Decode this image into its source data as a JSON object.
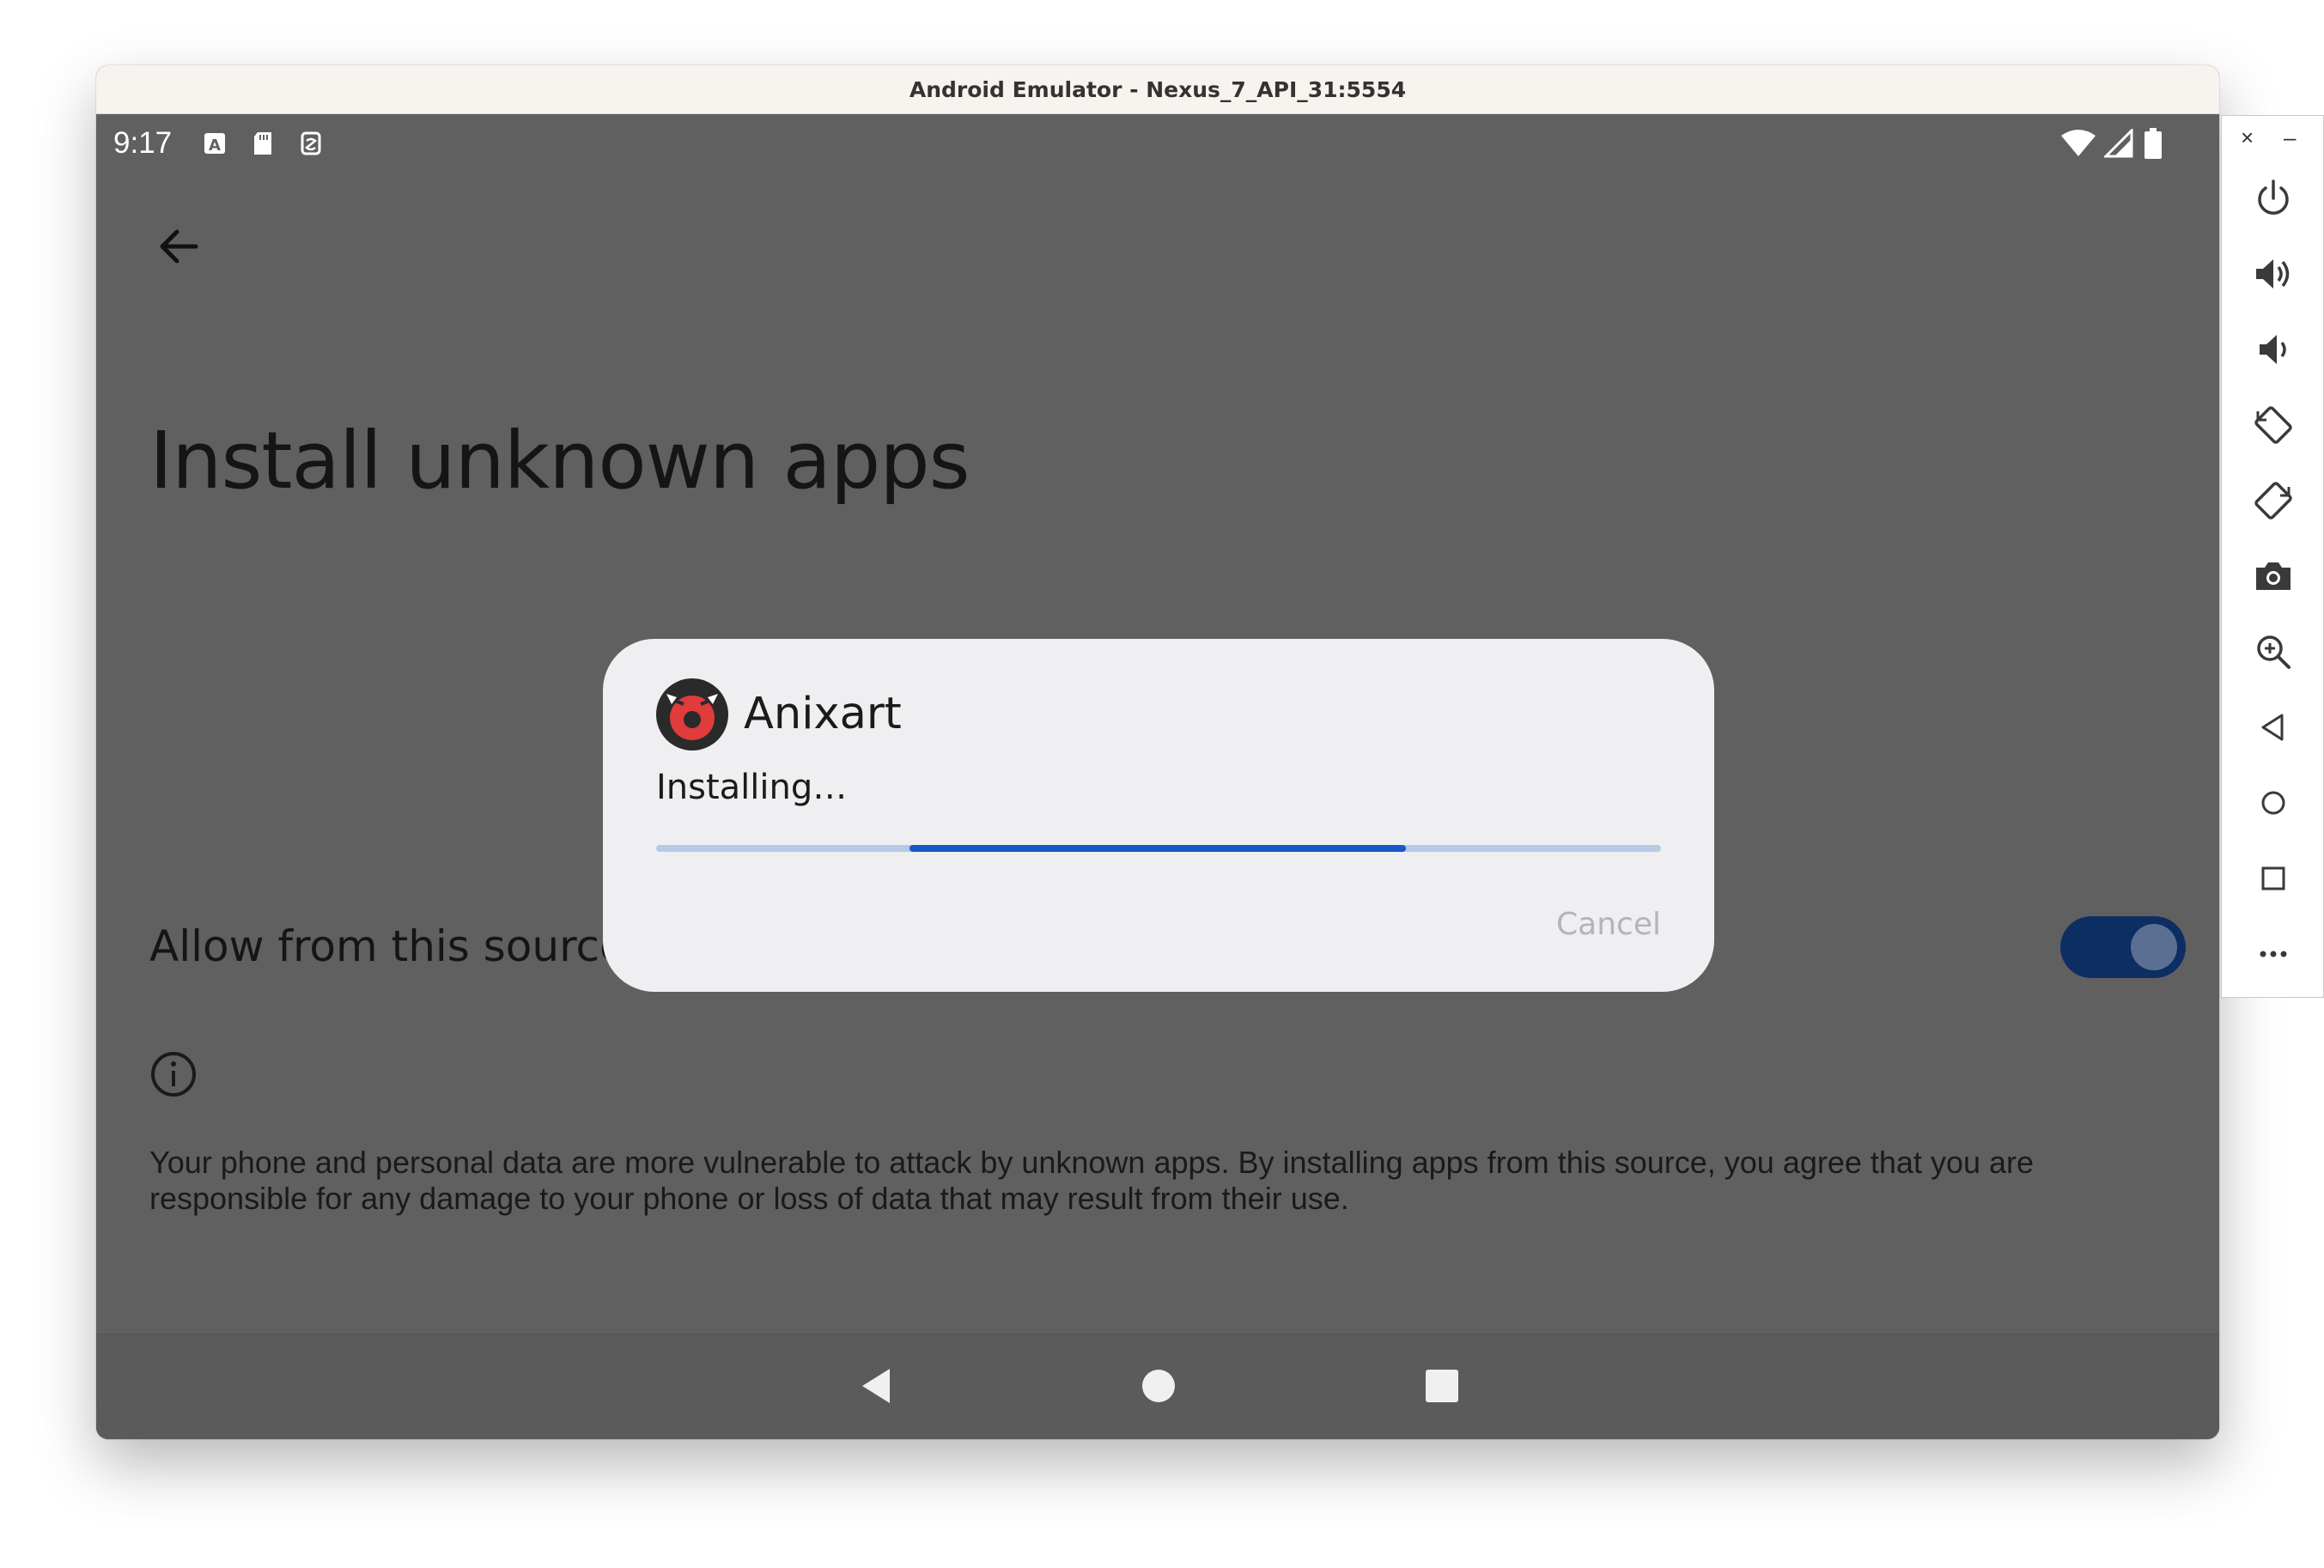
{
  "window": {
    "title": "Android Emulator - Nexus_7_API_31:5554"
  },
  "statusbar": {
    "time": "9:17",
    "left_icons": [
      "a-notification-icon",
      "sd-card-icon",
      "sim-icon"
    ],
    "right_icons": [
      "wifi-icon",
      "signal-icon",
      "battery-icon"
    ]
  },
  "page": {
    "title": "Install unknown apps",
    "allow_label": "Allow from this source",
    "allow_enabled": true,
    "warning_text": "Your phone and personal data are more vulnerable to attack by unknown apps. By installing apps from this source, you agree that you are responsible for any damage to your phone or loss of data that may result from their use."
  },
  "dialog": {
    "app_name": "Anixart",
    "status": "Installing…",
    "progress_indeterminate": true,
    "cancel_label": "Cancel"
  },
  "navbar": {
    "buttons": [
      "back-icon",
      "home-icon",
      "recents-icon"
    ]
  },
  "side_panel": {
    "top_controls": [
      "×",
      "–"
    ],
    "buttons": [
      "power-icon",
      "volume-up-icon",
      "volume-down-icon",
      "rotate-left-icon",
      "rotate-right-icon",
      "camera-icon",
      "zoom-icon",
      "back-icon",
      "home-icon",
      "overview-icon",
      "more-icon"
    ]
  },
  "colors": {
    "screen_bg": "#606060",
    "dialog_bg": "#efeff1",
    "progress_track": "#b6c9e6",
    "progress_fill": "#1657c9",
    "toggle_track": "#0d2e63",
    "app_icon_red": "#e03c3c"
  }
}
